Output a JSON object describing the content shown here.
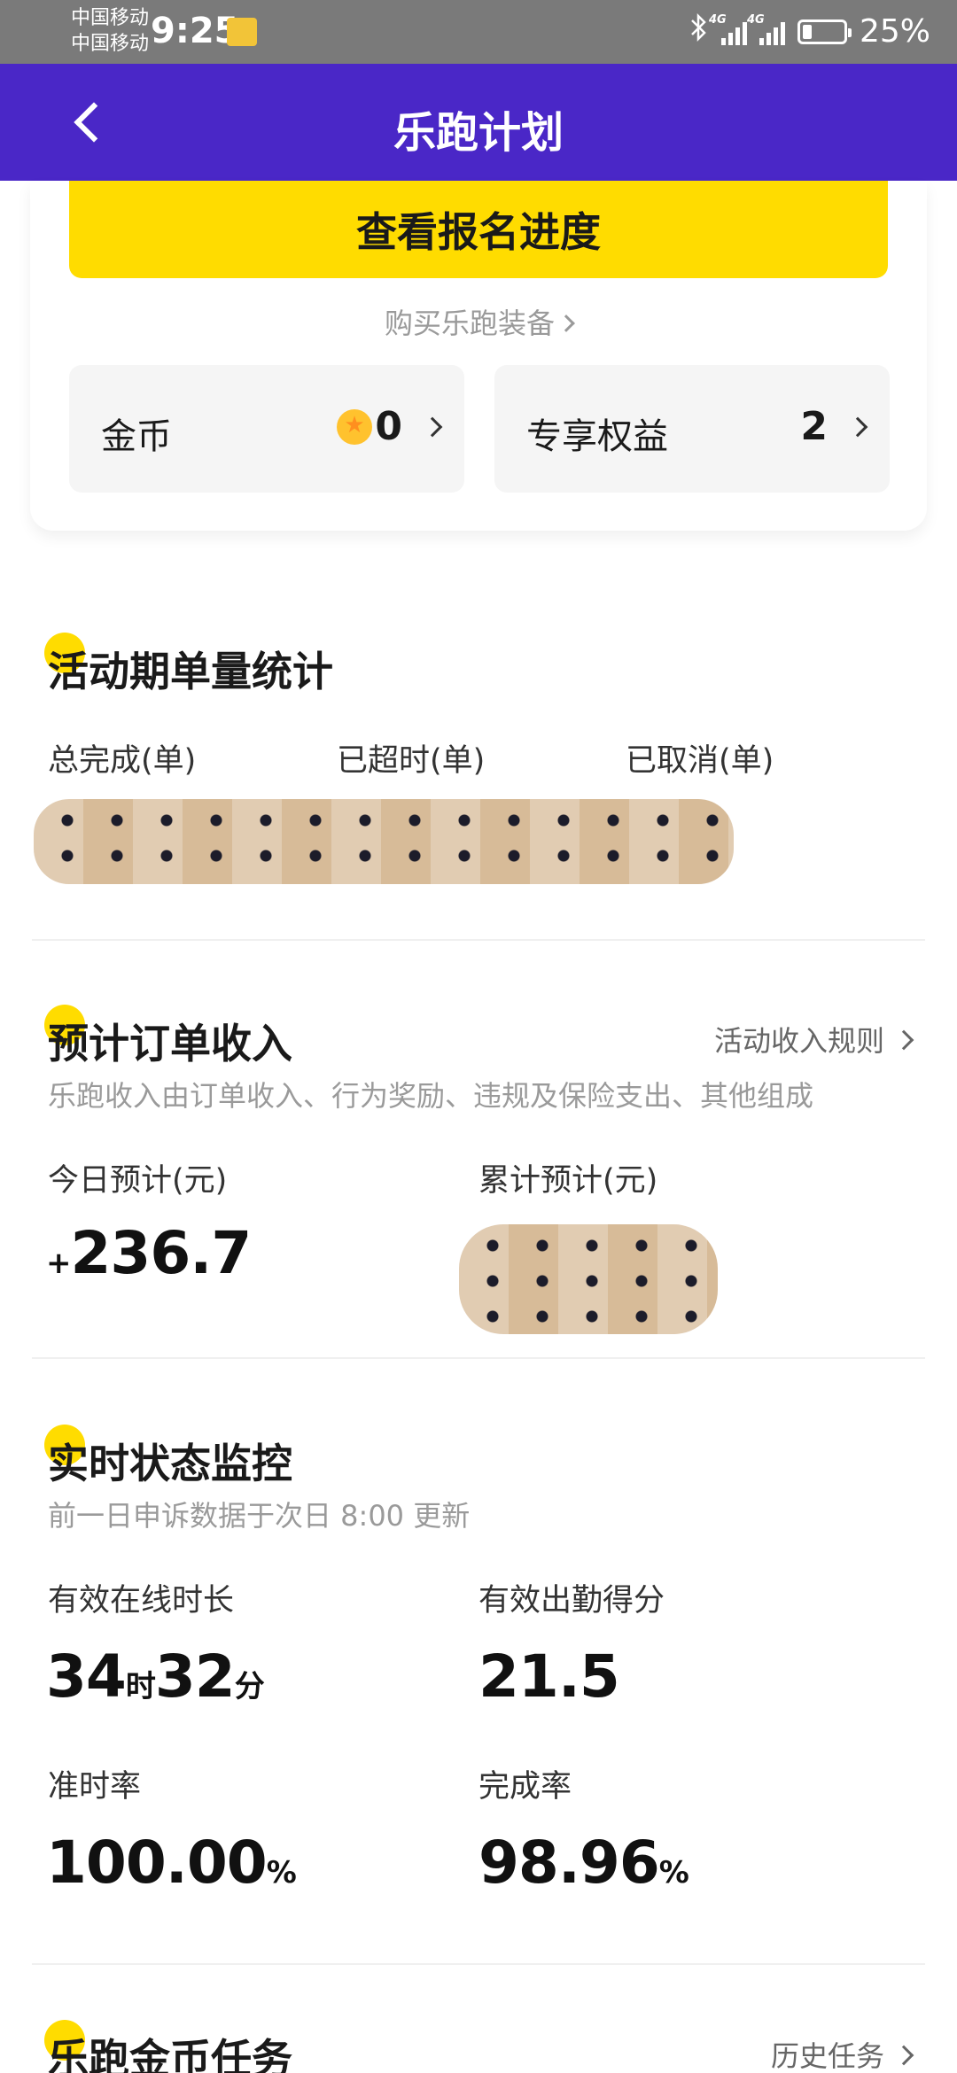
{
  "status_bar": {
    "carrier_1": "中国移动",
    "carrier_2": "中国移动",
    "time": "9:25",
    "signal_tag_1": "4G",
    "signal_tag_2": "4G",
    "battery": "25%"
  },
  "header": {
    "title": "乐跑计划"
  },
  "top_card": {
    "cta_label": "查看报名进度",
    "buy_link": "购买乐跑装备",
    "coins_label": "金币",
    "coins_value": "0",
    "benefits_label": "专享权益",
    "benefits_value": "2"
  },
  "order_stats": {
    "title": "活动期单量统计",
    "col1": "总完成(单)",
    "col2": "已超时(单)",
    "col3": "已取消(单)"
  },
  "income": {
    "title": "预计订单收入",
    "rules_link": "活动收入规则",
    "subtitle": "乐跑收入由订单收入、行为奖励、违规及保险支出、其他组成",
    "today_label": "今日预计(元)",
    "today_sign": "+",
    "today_value": "236.7",
    "total_label": "累计预计(元)"
  },
  "monitor": {
    "title": "实时状态监控",
    "subtitle": "前一日申诉数据于次日 8:00 更新",
    "online_label": "有效在线时长",
    "online_hours": "34",
    "hours_unit": "时",
    "online_minutes": "32",
    "minutes_unit": "分",
    "score_label": "有效出勤得分",
    "score_value": "21.5",
    "ontime_label": "准时率",
    "ontime_value": "100.00",
    "complete_label": "完成率",
    "complete_value": "98.96",
    "percent": "%"
  },
  "tasks": {
    "title": "乐跑金币任务",
    "history_link": "历史任务"
  }
}
